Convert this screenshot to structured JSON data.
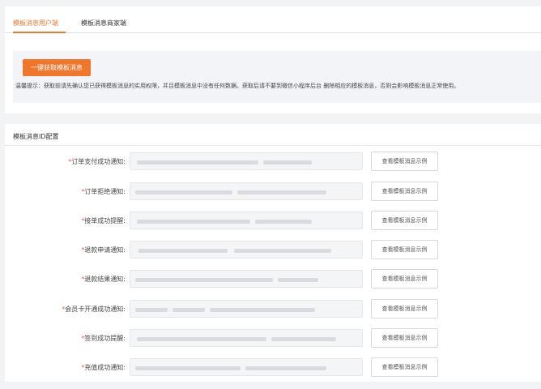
{
  "tabs": [
    {
      "label": "模板消息用户端",
      "active": true
    },
    {
      "label": "模板消息商家端",
      "active": false
    }
  ],
  "notice": {
    "button_label": "一键获取模板消息",
    "tip": "温馨提示：获取前请先确认您已获得模板消息的实用权限，并且模板消息中没有任何数据。获取后请不要到微信小程序后台 删除相应的模板消息，否则会影响模板消息正常使用。"
  },
  "config": {
    "title": "模板消息ID配置",
    "view_button_label": "查看模板消息示例",
    "rows": [
      {
        "label": "订单支付成功通知:",
        "required": "*"
      },
      {
        "label": "订单拒绝通知:",
        "required": "*"
      },
      {
        "label": "接单成功提醒:",
        "required": "*"
      },
      {
        "label": "退款申请通知:",
        "required": "*"
      },
      {
        "label": "退款结果通知:",
        "required": "*"
      },
      {
        "label": "会员卡开通成功通知:",
        "required": "*"
      },
      {
        "label": "签到成功提醒:",
        "required": "*"
      },
      {
        "label": "充值成功通知:",
        "required": "*"
      }
    ]
  },
  "colors": {
    "accent": "#f0762c",
    "required": "#f05a4a"
  }
}
